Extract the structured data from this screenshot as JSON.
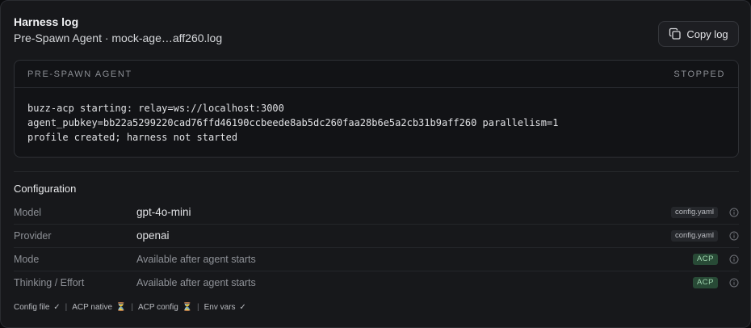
{
  "header": {
    "title": "Harness log",
    "subtitle": "Pre-Spawn Agent · mock-age…aff260.log",
    "copy_button_label": "Copy log",
    "copy_icon": "copy-icon"
  },
  "log": {
    "section_label": "PRE-SPAWN AGENT",
    "status": "STOPPED",
    "lines": [
      "buzz-acp starting: relay=ws://localhost:3000",
      "agent_pubkey=bb22a5299220cad76ffd46190ccbeede8ab5dc260faa28b6e5a2cb31b9aff260 parallelism=1",
      "profile created; harness not started"
    ]
  },
  "configuration": {
    "title": "Configuration",
    "rows": [
      {
        "label": "Model",
        "value": "gpt-4o-mini",
        "badge": "config.yaml",
        "info_icon": "info-icon"
      },
      {
        "label": "Provider",
        "value": "openai",
        "badge": "config.yaml",
        "info_icon": "info-icon"
      },
      {
        "label": "Mode",
        "value": "Available after agent starts",
        "badge": "ACP",
        "info_icon": "info-icon"
      },
      {
        "label": "Thinking / Effort",
        "value": "Available after agent starts",
        "badge": "ACP",
        "info_icon": "info-icon"
      }
    ]
  },
  "footer": {
    "items": [
      {
        "label": "Config file",
        "mark": "✓"
      },
      {
        "label": "ACP native",
        "mark": "⏳"
      },
      {
        "label": "ACP config",
        "mark": "⏳"
      },
      {
        "label": "Env vars",
        "mark": "✓"
      }
    ],
    "separator": "|"
  },
  "colors": {
    "panel_bg": "#17181b",
    "log_bg": "#121316",
    "acp_badge_bg": "#284a36",
    "acp_badge_text": "#9fd3ae",
    "muted_text": "#8d9096"
  }
}
